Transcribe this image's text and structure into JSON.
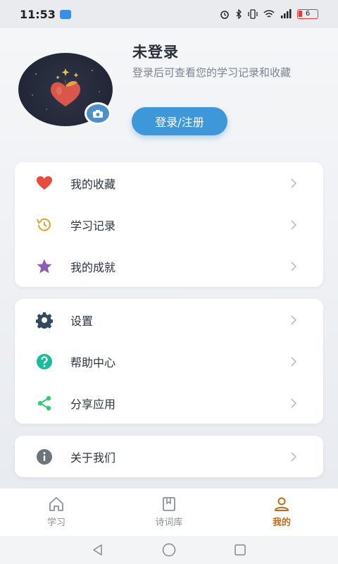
{
  "status_bar": {
    "time": "11:53",
    "battery": "6"
  },
  "profile": {
    "name": "未登录",
    "description": "登录后可查看您的学习记录和收藏",
    "login_button": "登录/注册"
  },
  "menu_groups": [
    {
      "items": [
        {
          "icon": "heart-icon",
          "label": "我的收藏",
          "color": "#e74c3c"
        },
        {
          "icon": "history-icon",
          "label": "学习记录",
          "color": "#e0a030"
        },
        {
          "icon": "star-icon",
          "label": "我的成就",
          "color": "#8e5bb5"
        }
      ]
    },
    {
      "items": [
        {
          "icon": "gear-icon",
          "label": "设置",
          "color": "#34495e"
        },
        {
          "icon": "help-icon",
          "label": "帮助中心",
          "color": "#1abc9c"
        },
        {
          "icon": "share-icon",
          "label": "分享应用",
          "color": "#2ecc71"
        }
      ]
    },
    {
      "items": [
        {
          "icon": "info-icon",
          "label": "关于我们",
          "color": "#6d747c"
        }
      ]
    }
  ],
  "tabs": [
    {
      "icon": "home-icon",
      "label": "学习",
      "active": false
    },
    {
      "icon": "book-icon",
      "label": "诗词库",
      "active": false
    },
    {
      "icon": "user-icon",
      "label": "我的",
      "active": true
    }
  ],
  "colors": {
    "accent": "#3d97d8",
    "active_tab": "#c26a1a"
  }
}
